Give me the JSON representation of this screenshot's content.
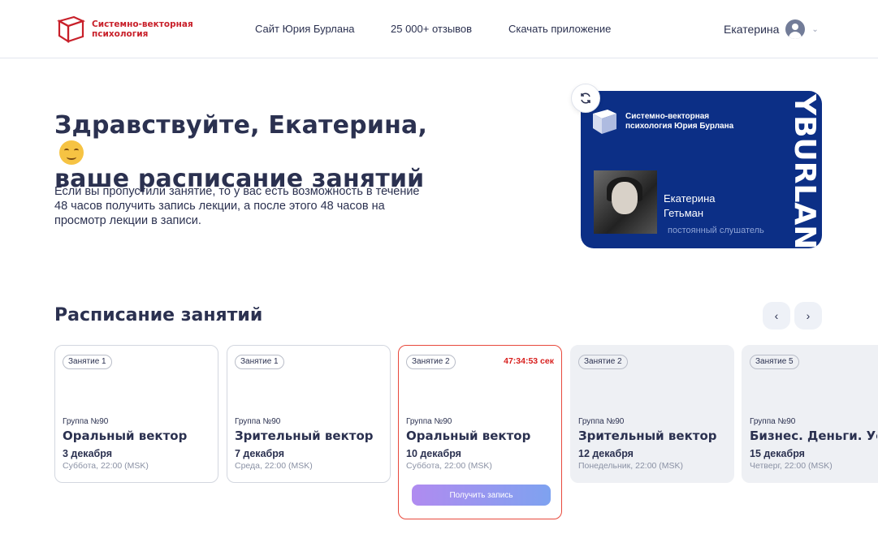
{
  "header": {
    "logo_text": "Системно-векторная психология",
    "nav": [
      "Сайт Юрия Бурлана",
      "25 000+ отзывов",
      "Скачать приложение"
    ],
    "user_name": "Екатерина"
  },
  "hero": {
    "title_line1": "Здравствуйте, Екатерина,",
    "title_line2": "ваше расписание занятий",
    "description": "Если вы пропустили занятие, то у вас есть возможность в течение 48 часов получить запись лекции, а после этого 48 часов на просмотр лекции в записи."
  },
  "card": {
    "logo_text": "Системно-векторная психология Юрия Бурлана",
    "first_name": "Екатерина",
    "last_name": "Гетьман",
    "role": "постоянный слушатель",
    "vertical_text": "YBURLAN"
  },
  "schedule": {
    "title": "Расписание занятий",
    "lessons": [
      {
        "badge": "Занятие 1",
        "group": "Группа №90",
        "name": "Оральный вектор",
        "date": "3 декабря",
        "day": "Суббота, 22:00 (MSK)"
      },
      {
        "badge": "Занятие 1",
        "group": "Группа №90",
        "name": "Зрительный вектор",
        "date": "7 декабря",
        "day": "Среда, 22:00 (MSK)"
      },
      {
        "badge": "Занятие 2",
        "group": "Группа №90",
        "name": "Оральный вектор",
        "date": "10 декабря",
        "day": "Суббота, 22:00 (MSK)",
        "timer": "47:34:53 сек",
        "button": "Получить запись"
      },
      {
        "badge": "Занятие 2",
        "group": "Группа №90",
        "name": "Зрительный вектор",
        "date": "12 декабря",
        "day": "Понедельник, 22:00 (MSK)"
      },
      {
        "badge": "Занятие 5",
        "group": "Группа №90",
        "name": "Бизнес. Деньги. Ус",
        "date": "15 декабря",
        "day": "Четверг, 22:00 (MSK)"
      }
    ]
  },
  "colors": {
    "brand_red": "#c8202a",
    "card_blue": "#0c2f86",
    "timer_red": "#d8201e"
  }
}
